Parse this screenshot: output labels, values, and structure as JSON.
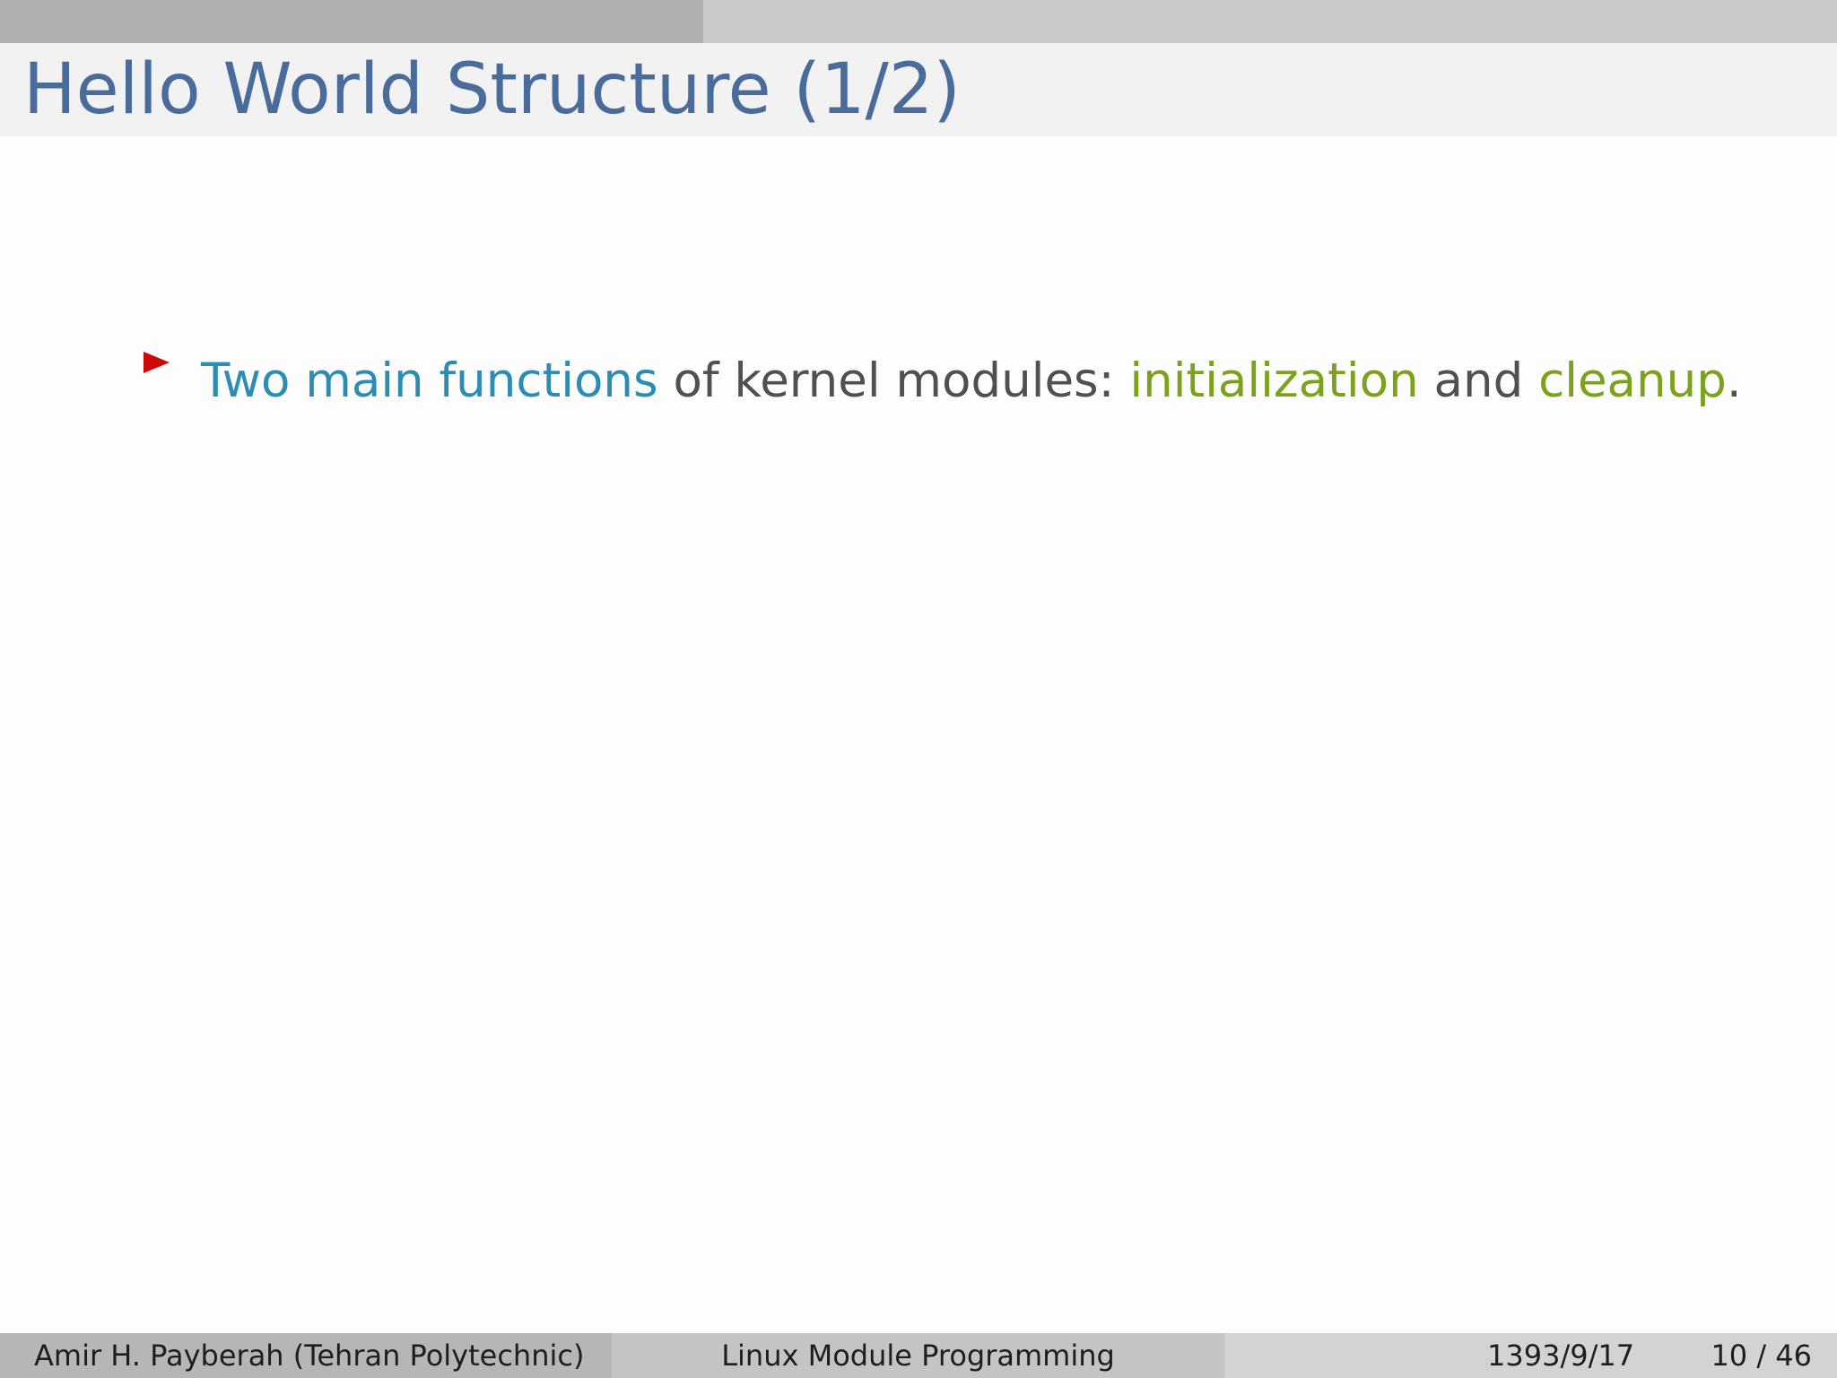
{
  "slide": {
    "title": "Hello World Structure (1/2)",
    "progress": 0.5
  },
  "bullets": [
    {
      "parts": [
        {
          "text": "Two main functions",
          "style": "blue"
        },
        {
          "text": " of kernel modules: ",
          "style": "plain"
        },
        {
          "text": "initialization",
          "style": "green"
        },
        {
          "text": " and ",
          "style": "plain"
        },
        {
          "text": "cleanup",
          "style": "green"
        },
        {
          "text": ".",
          "style": "plain"
        }
      ]
    }
  ],
  "footer": {
    "author": "Amir H. Payberah  (Tehran Polytechnic)",
    "title": "Linux Module Programming",
    "date": "1393/9/17",
    "page": "10 / 46"
  },
  "colors": {
    "title": "#4a6c9b",
    "bullet_marker": "#cc0a0a",
    "highlight_blue": "#2b8db3",
    "highlight_green": "#7aa21c",
    "body_text": "#505050"
  }
}
